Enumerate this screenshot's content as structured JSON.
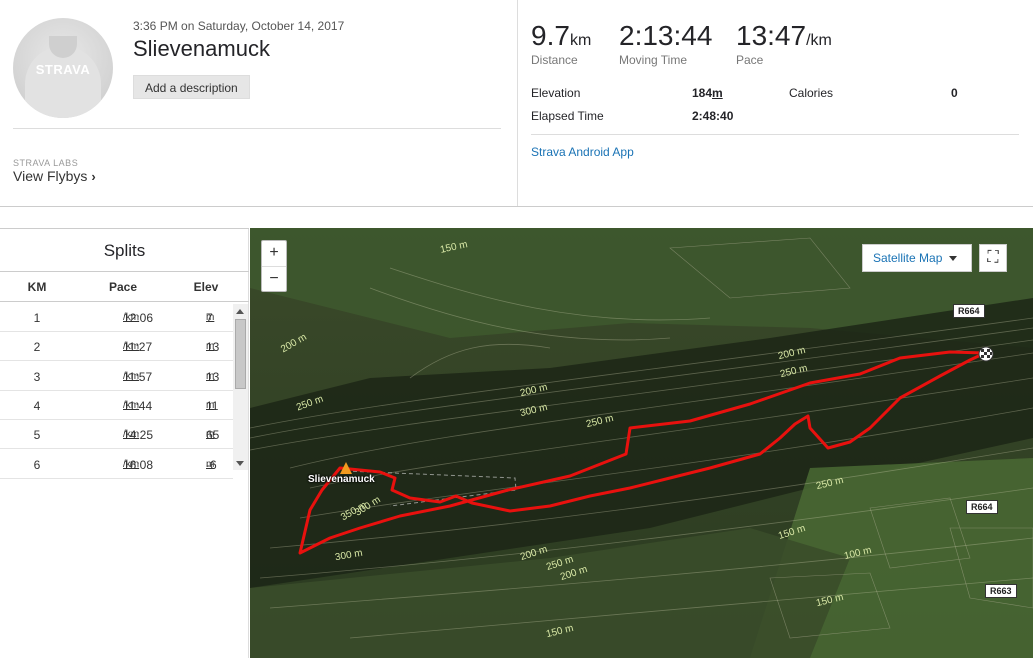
{
  "activity": {
    "datetime": "3:36 PM on Saturday, October 14, 2017",
    "name": "Slievenamuck",
    "add_description": "Add a description",
    "avatar_logo": "STRAVA"
  },
  "labs": {
    "label": "STRAVA LABS",
    "link": "View Flybys"
  },
  "stats": {
    "distance": {
      "value": "9.7",
      "unit": "km",
      "label": "Distance"
    },
    "moving_time": {
      "value": "2:13:44",
      "label": "Moving Time"
    },
    "pace": {
      "value": "13:47",
      "unit": "/km",
      "label": "Pace"
    }
  },
  "details": {
    "elevation_label": "Elevation",
    "elevation_value": "184",
    "elevation_unit": "m",
    "calories_label": "Calories",
    "calories_value": "0",
    "elapsed_label": "Elapsed Time",
    "elapsed_value": "2:48:40",
    "device": "Strava Android App"
  },
  "splits": {
    "title": "Splits",
    "headers": {
      "km": "KM",
      "pace": "Pace",
      "elev": "Elev"
    },
    "pace_unit": "/km",
    "elev_unit": "m",
    "rows": [
      {
        "km": "1",
        "pace": "12:06",
        "elev": "7"
      },
      {
        "km": "2",
        "pace": "11:27",
        "elev": "13"
      },
      {
        "km": "3",
        "pace": "11:57",
        "elev": "13"
      },
      {
        "km": "4",
        "pace": "11:44",
        "elev": "11"
      },
      {
        "km": "5",
        "pace": "14:25",
        "elev": "65"
      },
      {
        "km": "6",
        "pace": "16:08",
        "elev": "-6"
      }
    ]
  },
  "map": {
    "type_label": "Satellite Map",
    "zoom_in": "+",
    "zoom_out": "−",
    "place": "Slievenamuck",
    "roads": [
      "R664",
      "R664",
      "R663"
    ],
    "contours": [
      "150 m",
      "200 m",
      "200 m",
      "250 m",
      "200 m",
      "250 m",
      "300 m",
      "250 m",
      "300 m",
      "350 m",
      "300 m",
      "250 m",
      "200 m",
      "250 m",
      "150 m",
      "200 m",
      "150 m",
      "100 m",
      "150 m"
    ],
    "route_color": "#e8110e"
  }
}
